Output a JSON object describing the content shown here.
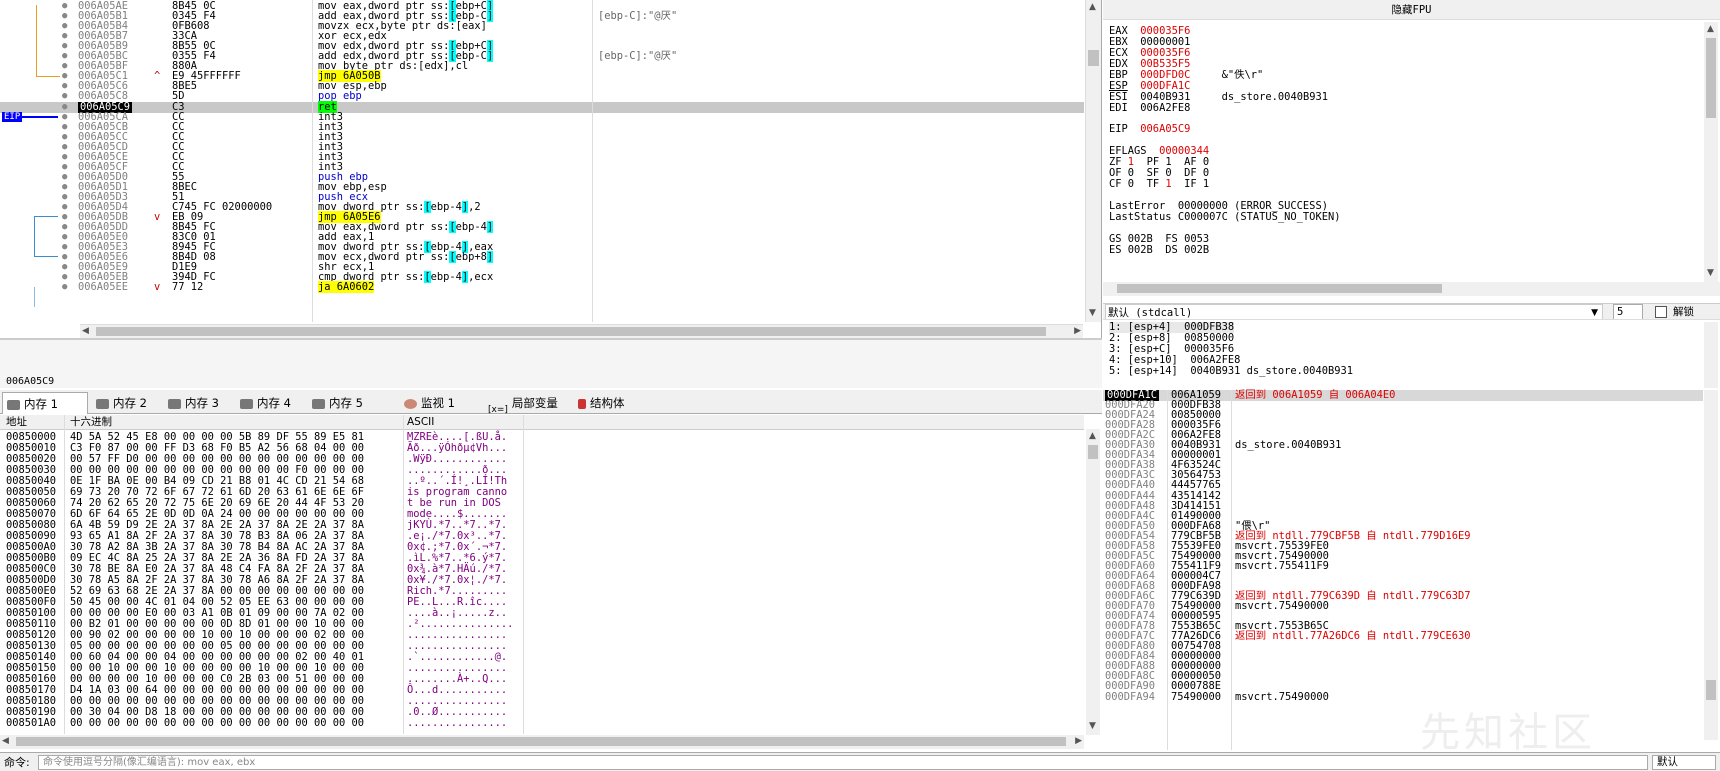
{
  "disasm": {
    "eip_label": "EIP",
    "rows": [
      {
        "addr": "006A05AE",
        "mark": "",
        "bytes": "8B45 0C",
        "ins": "mov eax,dword ptr ss:[ebp+C]",
        "cmt": ""
      },
      {
        "addr": "006A05B1",
        "mark": "",
        "bytes": "0345 F4",
        "ins": "add eax,dword ptr ss:[ebp-C]",
        "cmt": "[ebp-C]:\"@厌\""
      },
      {
        "addr": "006A05B4",
        "mark": "",
        "bytes": "0FB608",
        "ins": "movzx ecx,byte ptr ds:[eax]",
        "cmt": ""
      },
      {
        "addr": "006A05B7",
        "mark": "",
        "bytes": "33CA",
        "ins": "xor ecx,edx",
        "cmt": ""
      },
      {
        "addr": "006A05B9",
        "mark": "",
        "bytes": "8B55 0C",
        "ins": "mov edx,dword ptr ss:[ebp+C]",
        "cmt": ""
      },
      {
        "addr": "006A05BC",
        "mark": "",
        "bytes": "0355 F4",
        "ins": "add edx,dword ptr ss:[ebp-C]",
        "cmt": "[ebp-C]:\"@厌\""
      },
      {
        "addr": "006A05BF",
        "mark": "",
        "bytes": "880A",
        "ins": "mov byte ptr ds:[edx],cl",
        "cmt": ""
      },
      {
        "addr": "006A05C1",
        "mark": "^",
        "bytes": "E9 45FFFFFF",
        "ins": "jmp 6A050B",
        "cmt": ""
      },
      {
        "addr": "006A05C6",
        "mark": "",
        "bytes": "8BE5",
        "ins": "mov esp,ebp",
        "cmt": ""
      },
      {
        "addr": "006A05C8",
        "mark": "",
        "bytes": "5D",
        "ins": "pop ebp",
        "cmt": ""
      },
      {
        "addr": "006A05C9",
        "mark": "",
        "bytes": "C3",
        "ins": "ret",
        "cmt": ""
      },
      {
        "addr": "006A05CA",
        "mark": "",
        "bytes": "CC",
        "ins": "int3",
        "cmt": ""
      },
      {
        "addr": "006A05CB",
        "mark": "",
        "bytes": "CC",
        "ins": "int3",
        "cmt": ""
      },
      {
        "addr": "006A05CC",
        "mark": "",
        "bytes": "CC",
        "ins": "int3",
        "cmt": ""
      },
      {
        "addr": "006A05CD",
        "mark": "",
        "bytes": "CC",
        "ins": "int3",
        "cmt": ""
      },
      {
        "addr": "006A05CE",
        "mark": "",
        "bytes": "CC",
        "ins": "int3",
        "cmt": ""
      },
      {
        "addr": "006A05CF",
        "mark": "",
        "bytes": "CC",
        "ins": "int3",
        "cmt": ""
      },
      {
        "addr": "006A05D0",
        "mark": "",
        "bytes": "55",
        "ins": "push ebp",
        "cmt": ""
      },
      {
        "addr": "006A05D1",
        "mark": "",
        "bytes": "8BEC",
        "ins": "mov ebp,esp",
        "cmt": ""
      },
      {
        "addr": "006A05D3",
        "mark": "",
        "bytes": "51",
        "ins": "push ecx",
        "cmt": ""
      },
      {
        "addr": "006A05D4",
        "mark": "",
        "bytes": "C745 FC 02000000",
        "ins": "mov dword ptr ss:[ebp-4],2",
        "cmt": ""
      },
      {
        "addr": "006A05DB",
        "mark": "v",
        "bytes": "EB 09",
        "ins": "jmp 6A05E6",
        "cmt": ""
      },
      {
        "addr": "006A05DD",
        "mark": "",
        "bytes": "8B45 FC",
        "ins": "mov eax,dword ptr ss:[ebp-4]",
        "cmt": ""
      },
      {
        "addr": "006A05E0",
        "mark": "",
        "bytes": "83C0 01",
        "ins": "add eax,1",
        "cmt": ""
      },
      {
        "addr": "006A05E3",
        "mark": "",
        "bytes": "8945 FC",
        "ins": "mov dword ptr ss:[ebp-4],eax",
        "cmt": ""
      },
      {
        "addr": "006A05E6",
        "mark": "",
        "bytes": "8B4D 08",
        "ins": "mov ecx,dword ptr ss:[ebp+8]",
        "cmt": ""
      },
      {
        "addr": "006A05E9",
        "mark": "",
        "bytes": "D1E9",
        "ins": "shr ecx,1",
        "cmt": ""
      },
      {
        "addr": "006A05EB",
        "mark": "",
        "bytes": "394D FC",
        "ins": "cmp dword ptr ss:[ebp-4],ecx",
        "cmt": ""
      },
      {
        "addr": "006A05EE",
        "mark": "v",
        "bytes": "77 12",
        "ins": "ja 6A0602",
        "cmt": ""
      }
    ]
  },
  "info_text": "006A05C9",
  "registers": {
    "title": "隐藏FPU",
    "lines": [
      {
        "name": "EAX",
        "val": "000035F6",
        "extra": "",
        "red": true
      },
      {
        "name": "EBX",
        "val": "00000001",
        "extra": "",
        "red": false
      },
      {
        "name": "ECX",
        "val": "000035F6",
        "extra": "",
        "red": true
      },
      {
        "name": "EDX",
        "val": "00B535F5",
        "extra": "",
        "red": true
      },
      {
        "name": "EBP",
        "val": "000DFD0C",
        "extra": "&\"佚\\r\"",
        "red": true
      },
      {
        "name": "ESP",
        "val": "000DFA1C",
        "extra": "",
        "red": true
      },
      {
        "name": "ESI",
        "val": "0040B931",
        "extra": "ds_store.0040B931",
        "red": false
      },
      {
        "name": "EDI",
        "val": "006A2FE8",
        "extra": "",
        "red": false
      }
    ],
    "eip_name": "EIP",
    "eip_val": "006A05C9",
    "eflags_name": "EFLAGS",
    "eflags_val": "00000344",
    "flags_rows": [
      [
        {
          "n": "ZF",
          "v": "1",
          "r": true
        },
        {
          "n": "PF",
          "v": "1",
          "r": false
        },
        {
          "n": "AF",
          "v": "0",
          "r": false
        }
      ],
      [
        {
          "n": "OF",
          "v": "0",
          "r": false
        },
        {
          "n": "SF",
          "v": "0",
          "r": false
        },
        {
          "n": "DF",
          "v": "0",
          "r": false
        }
      ],
      [
        {
          "n": "CF",
          "v": "0",
          "r": false
        },
        {
          "n": "TF",
          "v": "1",
          "r": true
        },
        {
          "n": "IF",
          "v": "1",
          "r": false
        }
      ]
    ],
    "last_error": "LastError  00000000 (ERROR_SUCCESS)",
    "last_status": "LastStatus C000007C (STATUS_NO_TOKEN)",
    "seg_line": "GS 002B  FS 0053",
    "seg_line2": "ES 002B  DS 002B"
  },
  "callconv": {
    "selected": "默认 (stdcall)",
    "count": "5",
    "unlock_label": "解锁"
  },
  "args": [
    "1: [esp+4]  000DFB38",
    "2: [esp+8]  00850000",
    "3: [esp+C]  000035F6",
    "4: [esp+10]  006A2FE8",
    "5: [esp+14]  0040B931 ds_store.0040B931"
  ],
  "tabs": [
    "内存 1",
    "内存 2",
    "内存 3",
    "内存 4",
    "内存 5",
    "监视 1",
    "局部变量",
    "结构体"
  ],
  "tab_prefix_locals": "[x=]",
  "dump": {
    "col_addr": "地址",
    "col_hex": "十六进制",
    "col_ascii": "ASCII",
    "rows": [
      {
        "a": "00850000",
        "h": "4D 5A 52 45 E8 00 00 00 00 5B 89 DF 55 89 E5 81",
        "s": "MZREè....[.ßU.å."
      },
      {
        "a": "00850010",
        "h": "C3 F0 87 00 00 FF D3 68 F0 B5 A2 56 68 04 00 00",
        "s": "Ãð...ÿÓhðµ¢Vh..."
      },
      {
        "a": "00850020",
        "h": "00 57 FF D0 00 00 00 00 00 00 00 00 00 00 00 00",
        "s": ".WÿÐ............"
      },
      {
        "a": "00850030",
        "h": "00 00 00 00 00 00 00 00 00 00 00 00 F0 00 00 00",
        "s": "............ð..."
      },
      {
        "a": "00850040",
        "h": "0E 1F BA 0E 00 B4 09 CD 21 B8 01 4C CD 21 54 68",
        "s": "..º..´.Í!¸.LÍ!Th"
      },
      {
        "a": "00850050",
        "h": "69 73 20 70 72 6F 67 72 61 6D 20 63 61 6E 6E 6F",
        "s": "is program canno"
      },
      {
        "a": "00850060",
        "h": "74 20 62 65 20 72 75 6E 20 69 6E 20 44 4F 53 20",
        "s": "t be run in DOS "
      },
      {
        "a": "00850070",
        "h": "6D 6F 64 65 2E 0D 0D 0A 24 00 00 00 00 00 00 00",
        "s": "mode....$......."
      },
      {
        "a": "00850080",
        "h": "6A 4B 59 D9 2E 2A 37 8A 2E 2A 37 8A 2E 2A 37 8A",
        "s": "jKYÙ.*7..*7..*7."
      },
      {
        "a": "00850090",
        "h": "93 65 A1 8A 2F 2A 37 8A 30 78 B3 8A 06 2A 37 8A",
        "s": ".e¡./*7.0x³..*7."
      },
      {
        "a": "008500A0",
        "h": "30 78 A2 8A 3B 2A 37 8A 30 78 B4 8A AC 2A 37 8A",
        "s": "0x¢.;*7.0x´.¬*7."
      },
      {
        "a": "008500B0",
        "h": "09 EC 4C 8A 25 2A 37 8A 2E 2A 36 8A FD 2A 37 8A",
        "s": ".ìL.%*7..*6.ý*7."
      },
      {
        "a": "008500C0",
        "h": "30 78 BE 8A E0 2A 37 8A 48 C4 FA 8A 2F 2A 37 8A",
        "s": "0x¾.à*7.HÄú./*7."
      },
      {
        "a": "008500D0",
        "h": "30 78 A5 8A 2F 2A 37 8A 30 78 A6 8A 2F 2A 37 8A",
        "s": "0x¥./*7.0x¦./*7."
      },
      {
        "a": "008500E0",
        "h": "52 69 63 68 2E 2A 37 8A 00 00 00 00 00 00 00 00",
        "s": "Rich.*7........."
      },
      {
        "a": "008500F0",
        "h": "50 45 00 00 4C 01 04 00 52 05 EE 63 00 00 00 00",
        "s": "PE..L...R.îc...."
      },
      {
        "a": "00850100",
        "h": "00 00 00 00 E0 00 03 A1 0B 01 09 00 00 7A 02 00",
        "s": "....à..¡.....z.."
      },
      {
        "a": "00850110",
        "h": "00 B2 01 00 00 00 00 00 0D 8D 01 00 00 10 00 00",
        "s": ".²..............."
      },
      {
        "a": "00850120",
        "h": "00 90 02 00 00 00 00 10 00 10 00 00 00 02 00 00",
        "s": "................"
      },
      {
        "a": "00850130",
        "h": "05 00 00 00 00 00 00 00 05 00 00 00 00 00 00 00",
        "s": "................"
      },
      {
        "a": "00850140",
        "h": "00 60 04 00 00 04 00 00 00 00 00 00 02 00 40 01",
        "s": ".`............@."
      },
      {
        "a": "00850150",
        "h": "00 00 10 00 00 10 00 00 00 00 10 00 00 10 00 00",
        "s": "................"
      },
      {
        "a": "00850160",
        "h": "00 00 00 00 10 00 00 00 C0 2B 03 00 51 00 00 00",
        "s": "........À+..Q..."
      },
      {
        "a": "00850170",
        "h": "D4 1A 03 00 64 00 00 00 00 00 00 00 00 00 00 00",
        "s": "Ô...d..........."
      },
      {
        "a": "00850180",
        "h": "00 00 00 00 00 00 00 00 00 00 00 00 00 00 00 00",
        "s": "................"
      },
      {
        "a": "00850190",
        "h": "00 30 04 00 D8 18 00 00 00 00 00 00 00 00 00 00",
        "s": ".0..Ø..........."
      },
      {
        "a": "008501A0",
        "h": "00 00 00 00 00 00 00 00 00 00 00 00 00 00 00 00",
        "s": "................"
      }
    ]
  },
  "stack": [
    {
      "a": "000DFA1C",
      "v": "006A1059",
      "c": "返回到 006A1059 自 006A04E0",
      "red": true
    },
    {
      "a": "000DFA20",
      "v": "000DFB38",
      "c": "",
      "red": false
    },
    {
      "a": "000DFA24",
      "v": "00850000",
      "c": "",
      "red": false
    },
    {
      "a": "000DFA28",
      "v": "000035F6",
      "c": "",
      "red": false
    },
    {
      "a": "000DFA2C",
      "v": "006A2FE8",
      "c": "",
      "red": false
    },
    {
      "a": "000DFA30",
      "v": "0040B931",
      "c": "ds_store.0040B931",
      "red": false
    },
    {
      "a": "000DFA34",
      "v": "00000001",
      "c": "",
      "red": false
    },
    {
      "a": "000DFA38",
      "v": "4F63524C",
      "c": "",
      "red": false
    },
    {
      "a": "000DFA3C",
      "v": "30564753",
      "c": "",
      "red": false
    },
    {
      "a": "000DFA40",
      "v": "44457765",
      "c": "",
      "red": false
    },
    {
      "a": "000DFA44",
      "v": "43514142",
      "c": "",
      "red": false
    },
    {
      "a": "000DFA48",
      "v": "3D414151",
      "c": "",
      "red": false
    },
    {
      "a": "000DFA4C",
      "v": "01490000",
      "c": "",
      "red": false
    },
    {
      "a": "000DFA50",
      "v": "000DFA68",
      "c": "\"偎\\r\"",
      "red": false
    },
    {
      "a": "000DFA54",
      "v": "779CBF5B",
      "c": "返回到 ntdll.779CBF5B 自 ntdll.779D16E9",
      "red": true
    },
    {
      "a": "000DFA58",
      "v": "75539FE0",
      "c": "msvcrt.75539FE0",
      "red": false
    },
    {
      "a": "000DFA5C",
      "v": "75490000",
      "c": "msvcrt.75490000",
      "red": false
    },
    {
      "a": "000DFA60",
      "v": "755411F9",
      "c": "msvcrt.755411F9",
      "red": false
    },
    {
      "a": "000DFA64",
      "v": "000004C7",
      "c": "",
      "red": false
    },
    {
      "a": "000DFA68",
      "v": "000DFA98",
      "c": "",
      "red": false
    },
    {
      "a": "000DFA6C",
      "v": "779C639D",
      "c": "返回到 ntdll.779C639D 自 ntdll.779C63D7",
      "red": true
    },
    {
      "a": "000DFA70",
      "v": "75490000",
      "c": "msvcrt.75490000",
      "red": false
    },
    {
      "a": "000DFA74",
      "v": "00000595",
      "c": "",
      "red": false
    },
    {
      "a": "000DFA78",
      "v": "7553B65C",
      "c": "msvcrt.7553B65C",
      "red": false
    },
    {
      "a": "000DFA7C",
      "v": "77A26DC6",
      "c": "返回到 ntdll.77A26DC6 自 ntdll.779CE630",
      "red": true
    },
    {
      "a": "000DFA80",
      "v": "00754708",
      "c": "",
      "red": false
    },
    {
      "a": "000DFA84",
      "v": "00000000",
      "c": "",
      "red": false
    },
    {
      "a": "000DFA88",
      "v": "00000000",
      "c": "",
      "red": false
    },
    {
      "a": "000DFA8C",
      "v": "00000050",
      "c": "",
      "red": false
    },
    {
      "a": "000DFA90",
      "v": "0000788E",
      "c": "",
      "red": false
    },
    {
      "a": "000DFA94",
      "v": "75490000",
      "c": "msvcrt.75490000",
      "red": false
    }
  ],
  "cmd": {
    "label": "命令:",
    "placeholder": "命令使用逗号分隔(像汇编语言): mov eax, ebx",
    "mode": "默认"
  },
  "watermark": "先知社区"
}
